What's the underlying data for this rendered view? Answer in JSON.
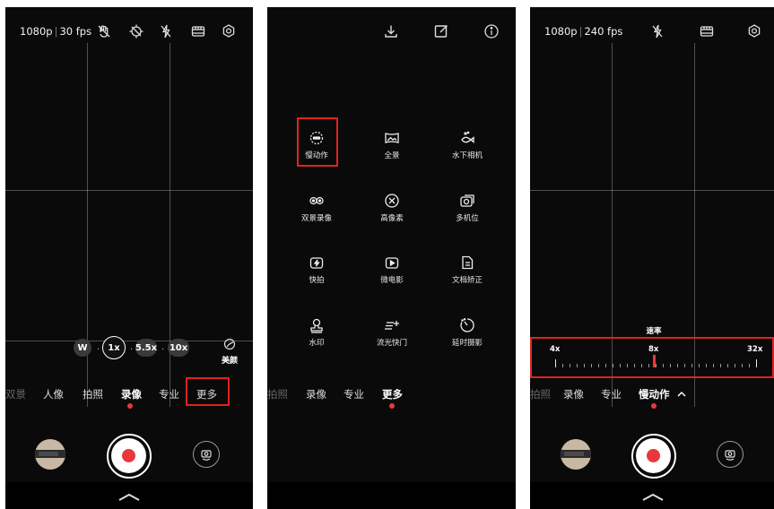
{
  "screen1": {
    "resolution": "1080p",
    "fps": "30 fps",
    "zoom": {
      "w": "W",
      "x1": "1x",
      "x55": "5.5x",
      "x10": "10x",
      "dot": "·"
    },
    "beauty_label": "美颜",
    "modes": [
      "双景",
      "人像",
      "拍照",
      "录像",
      "专业",
      "更多"
    ],
    "active_mode": "录像",
    "icons": [
      "anti-shake-off-icon",
      "target-lock-icon",
      "flash-off-icon",
      "film-strip-icon",
      "settings-icon"
    ]
  },
  "screen2": {
    "menu": [
      {
        "label": "慢动作",
        "icon": "slow-motion-icon"
      },
      {
        "label": "全景",
        "icon": "panorama-icon"
      },
      {
        "label": "水下相机",
        "icon": "underwater-camera-icon"
      },
      {
        "label": "双景录像",
        "icon": "dual-view-icon"
      },
      {
        "label": "高像素",
        "icon": "high-pixel-icon"
      },
      {
        "label": "多机位",
        "icon": "multi-camera-icon"
      },
      {
        "label": "快拍",
        "icon": "quick-shot-icon"
      },
      {
        "label": "微电影",
        "icon": "micro-movie-icon"
      },
      {
        "label": "文档矫正",
        "icon": "document-correction-icon"
      },
      {
        "label": "水印",
        "icon": "watermark-icon"
      },
      {
        "label": "流光快门",
        "icon": "light-painting-icon"
      },
      {
        "label": "延时摄影",
        "icon": "time-lapse-icon"
      }
    ],
    "modes": [
      "拍照",
      "录像",
      "专业",
      "更多"
    ],
    "active_mode": "更多",
    "icons": [
      "download-icon",
      "edit-icon",
      "info-icon"
    ]
  },
  "screen3": {
    "resolution": "1080p",
    "fps": "240 fps",
    "rate_title": "速率",
    "rate_labels": [
      "4x",
      "8x",
      "32x"
    ],
    "selected_rate": "8x",
    "modes": [
      "拍照",
      "录像",
      "专业",
      "慢动作"
    ],
    "active_mode": "慢动作",
    "icons": [
      "flash-off-icon",
      "film-strip-icon",
      "settings-icon"
    ]
  },
  "colors": {
    "accent_red": "#e8383d",
    "highlight_red": "#e0221f",
    "background": "#0a0a0a"
  }
}
